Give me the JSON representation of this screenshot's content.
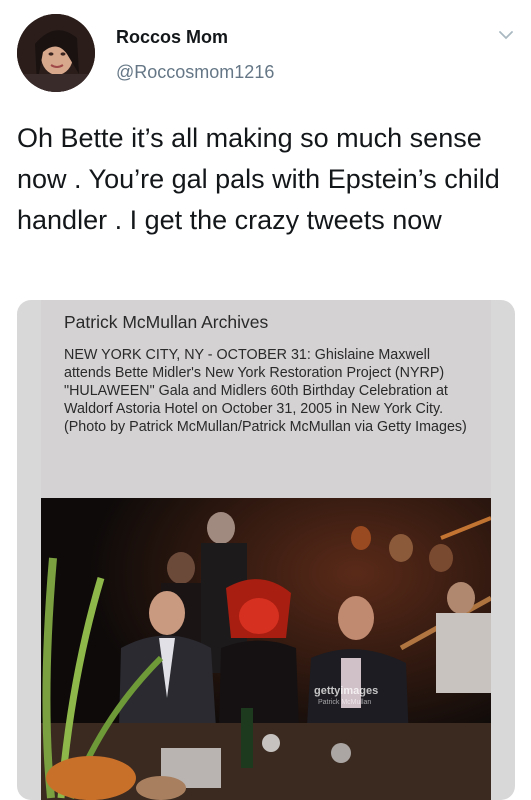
{
  "tweet": {
    "author_name": "Roccos Mom",
    "author_handle": "@Roccosmom1216",
    "text": "Oh Bette it’s all making so much sense now . You’re gal pals with Epstein’s child handler . I get the crazy tweets now"
  },
  "media": {
    "caption_title": "Patrick McMullan Archives",
    "caption_body": "NEW YORK CITY, NY - OCTOBER 31: Ghislaine Maxwell attends Bette Midler's New York Restoration Project (NYRP) \"HULAWEEN\" Gala and Midlers 60th Birthday Celebration at Waldorf Astoria Hotel on October 31, 2005 in New York City. (Photo by Patrick McMullan/Patrick McMullan via Getty Images)",
    "watermark": "gettyimages",
    "watermark_credit": "Patrick McMullan"
  },
  "icons": {
    "chevron": "chevron-down-icon",
    "avatar": "profile-photo"
  },
  "colors": {
    "handle": "#657786",
    "text": "#14171a",
    "caption_bg": "#d4d2d3"
  }
}
